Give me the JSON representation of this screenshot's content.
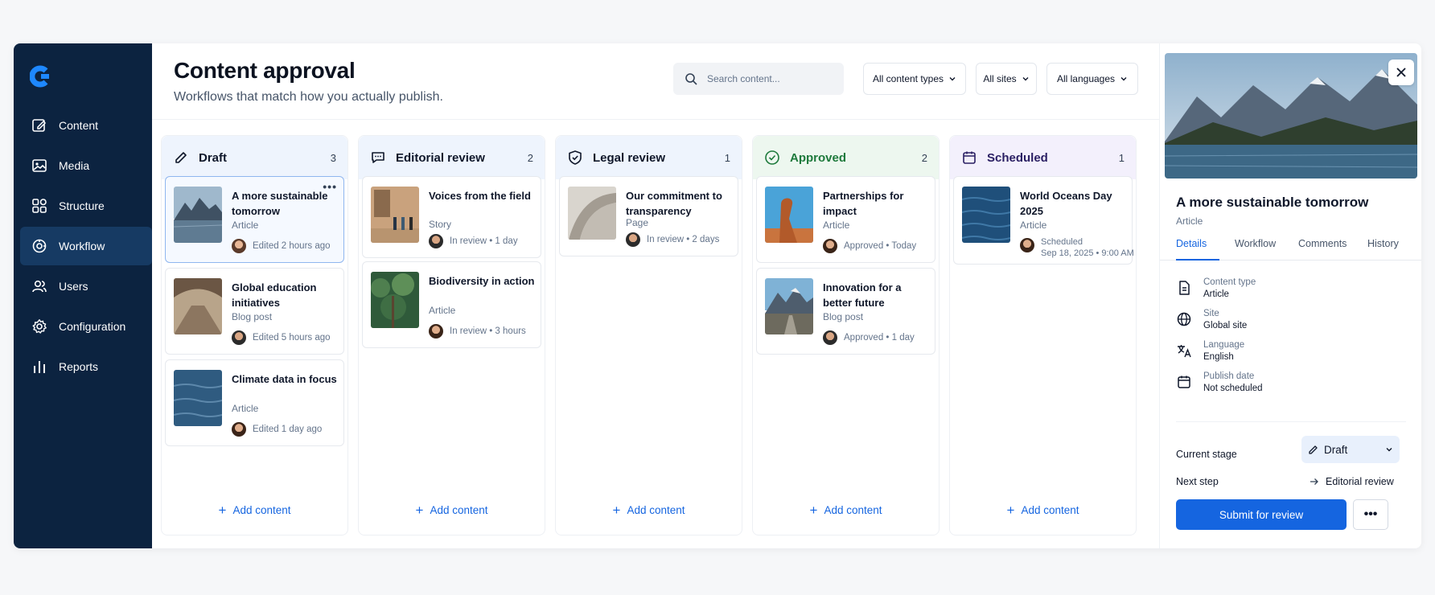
{
  "sidebar": {
    "items": [
      {
        "label": "Content",
        "icon": "edit-icon"
      },
      {
        "label": "Media",
        "icon": "image-icon"
      },
      {
        "label": "Structure",
        "icon": "grid-icon"
      },
      {
        "label": "Workflow",
        "icon": "workflow-icon",
        "active": true
      },
      {
        "label": "Users",
        "icon": "users-icon"
      },
      {
        "label": "Configuration",
        "icon": "gear-icon"
      },
      {
        "label": "Reports",
        "icon": "bar-chart-icon"
      }
    ]
  },
  "header": {
    "title": "Content approval",
    "subtitle": "Workflows that match how you actually publish.",
    "search_placeholder": "Search content...",
    "filters": [
      "All content types",
      "All sites",
      "All languages"
    ]
  },
  "columns": [
    {
      "title": "Draft",
      "count": "3",
      "cards": [
        {
          "title": "A more sustainable tomorrow",
          "type": "Article",
          "meta": "Edited 2 hours ago"
        },
        {
          "title": "Global education initiatives",
          "type": "Blog post",
          "meta": "Edited 5 hours ago"
        },
        {
          "title": "Climate data in focus",
          "type": "Article",
          "meta": "Edited 1 day ago"
        }
      ]
    },
    {
      "title": "Editorial review",
      "count": "2",
      "cards": [
        {
          "title": "Voices from the field",
          "type": "Story",
          "meta": "In review • 1 day"
        },
        {
          "title": "Biodiversity in action",
          "type": "Article",
          "meta": "In review • 3 hours"
        }
      ]
    },
    {
      "title": "Legal review",
      "count": "1",
      "cards": [
        {
          "title": "Our commitment to transparency",
          "type": "Page",
          "meta": "In review • 2 days"
        }
      ]
    },
    {
      "title": "Approved",
      "count": "2",
      "cards": [
        {
          "title": "Partnerships for impact",
          "type": "Article",
          "meta": "Approved • Today"
        },
        {
          "title": "Innovation for a better future",
          "type": "Blog post",
          "meta": "Approved • 1 day"
        }
      ]
    },
    {
      "title": "Scheduled",
      "count": "1",
      "cards": [
        {
          "title": "World Oceans Day 2025",
          "type": "Article",
          "meta": "Scheduled",
          "meta2": "Sep 18, 2025 • 9:00 AM"
        }
      ]
    }
  ],
  "add_content_label": "Add content",
  "card_menu": "•••",
  "panel": {
    "title": "A more sustainable tomorrow",
    "type": "Article",
    "tabs": [
      "Details",
      "Workflow",
      "Comments",
      "History"
    ],
    "props": [
      {
        "label": "Content type",
        "value": "Article"
      },
      {
        "label": "Site",
        "value": "Global site"
      },
      {
        "label": "Language",
        "value": "English"
      },
      {
        "label": "Publish date",
        "value": "Not scheduled"
      }
    ],
    "current_stage_label": "Current stage",
    "current_stage": "Draft",
    "next_step_label": "Next step",
    "next_step": "Editorial review",
    "submit_label": "Submit for review",
    "more_label": "•••"
  },
  "colors": {
    "sidebar": "#0c2340",
    "accent": "#1565e0",
    "approved": "#1e7a3c",
    "scheduled": "#2a1f63"
  }
}
